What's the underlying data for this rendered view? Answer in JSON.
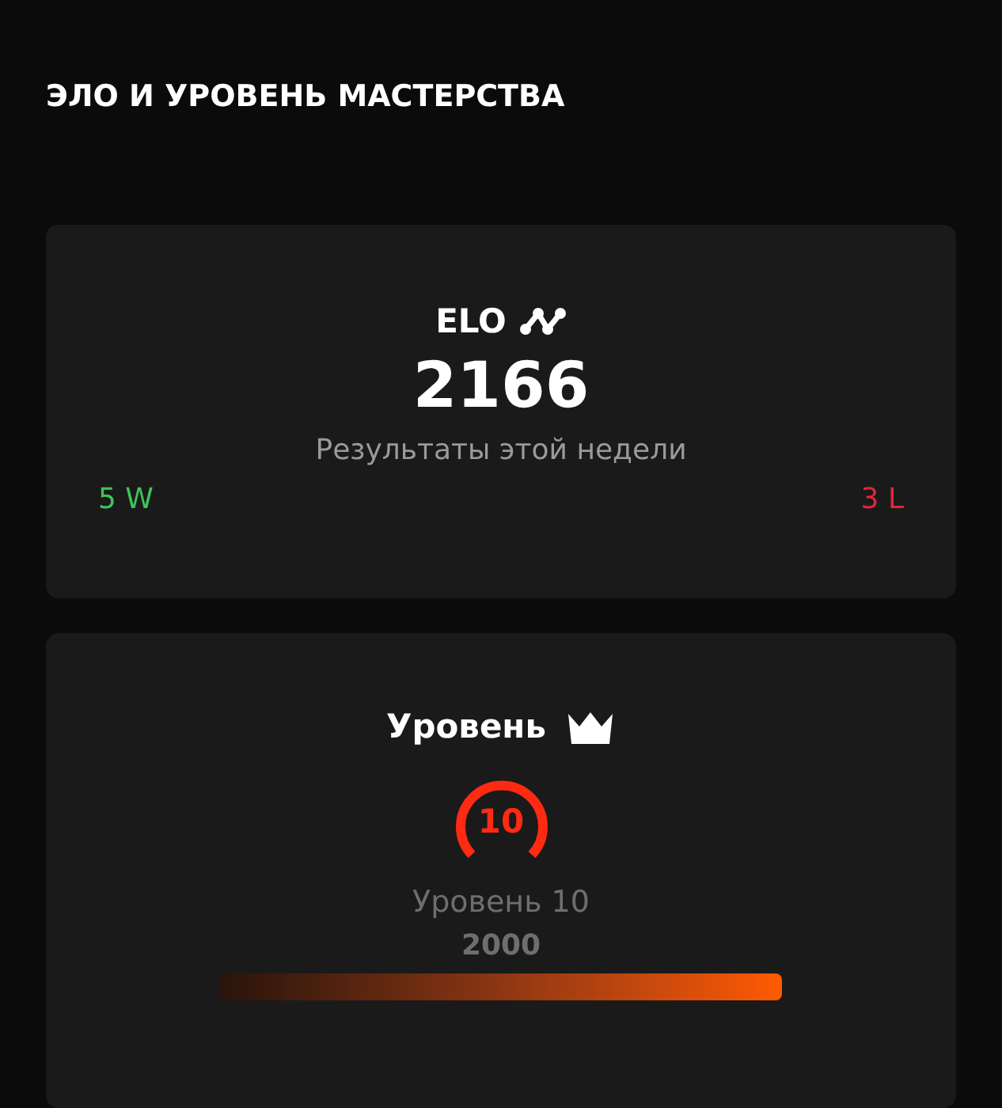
{
  "title": "ЭЛО И УРОВЕНЬ МАСТЕРСТВА",
  "elo": {
    "label": "ELO",
    "value": "2166",
    "subtitle": "Результаты этой недели",
    "wins": "5 W",
    "losses": "3 L"
  },
  "level": {
    "title": "Уровень",
    "badge": "10",
    "name": "Уровень 10",
    "points": "2000"
  }
}
